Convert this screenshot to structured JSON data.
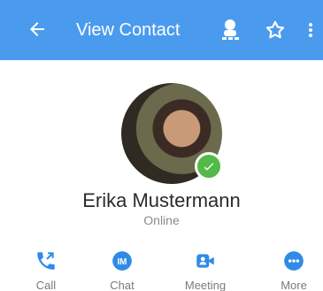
{
  "header": {
    "title": "View Contact",
    "icons": {
      "back": "arrow-left-icon",
      "agent": "agent-icon",
      "favorite": "star-outline-icon",
      "menu": "more-vertical-icon"
    },
    "color": "#4a9bee"
  },
  "contact": {
    "name": "Erika Mustermann",
    "status": "Online",
    "presence_color": "#53b948"
  },
  "actions": [
    {
      "label": "Call",
      "icon": "phone-icon"
    },
    {
      "label": "Chat",
      "icon": "chat-icon"
    },
    {
      "label": "Meeting",
      "icon": "video-icon"
    },
    {
      "label": "More",
      "icon": "more-horizontal-icon"
    }
  ]
}
